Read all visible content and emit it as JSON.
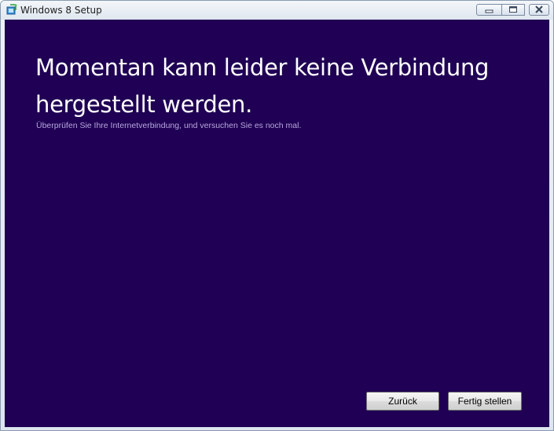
{
  "window": {
    "title": "Windows 8 Setup",
    "icon": "setup-app-icon",
    "controls": {
      "minimize": "minimize-icon",
      "maximize": "maximize-icon",
      "close": "close-icon"
    }
  },
  "content": {
    "headline": "Momentan kann leider keine Verbindung hergestellt werden.",
    "subtext": "Überprüfen Sie Ihre Internetverbindung, und versuchen Sie es noch mal."
  },
  "buttons": {
    "back_label": "Zurück",
    "finish_label": "Fertig stellen"
  },
  "colors": {
    "background": "#1f0054",
    "headline_text": "#ffffff",
    "subtext": "#b8a8dd"
  }
}
